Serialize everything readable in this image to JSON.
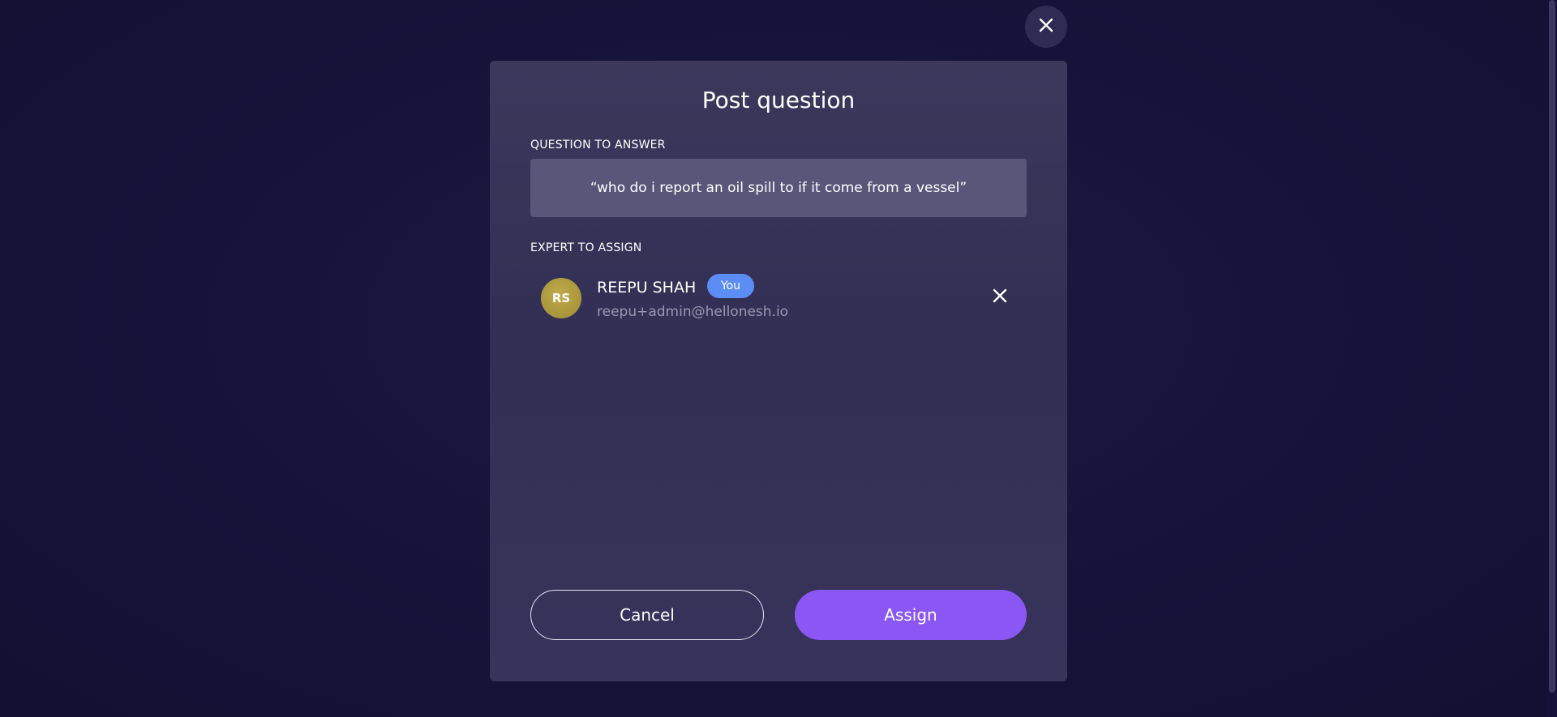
{
  "modal": {
    "title": "Post question",
    "question_label": "QUESTION TO ANSWER",
    "question_text": "“who do i report an oil spill to if it come from a vessel”",
    "expert_label": "EXPERT TO ASSIGN",
    "expert": {
      "initials": "RS",
      "name": "REEPU SHAH",
      "badge": "You",
      "email": "reepu+admin@hellonesh.io",
      "avatar_color": "#b09c40",
      "badge_color": "#5b8df5"
    },
    "cancel_label": "Cancel",
    "assign_label": "Assign",
    "accent_color": "#8a57f5"
  },
  "icons": {
    "close_modal": "close-icon",
    "remove_expert": "close-icon"
  }
}
